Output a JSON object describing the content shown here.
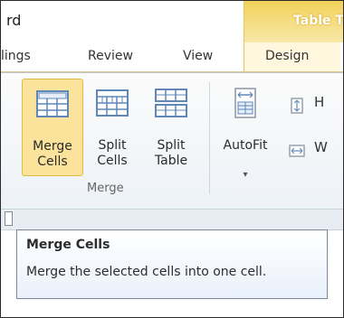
{
  "window": {
    "title_fragment": "rd",
    "contextual_tab_group": "Table T"
  },
  "ribbon_tabs": {
    "items": [
      {
        "label": "lings"
      },
      {
        "label": "Review"
      },
      {
        "label": "View"
      },
      {
        "label": "Design"
      }
    ],
    "active": "Design"
  },
  "merge_group": {
    "label": "Merge",
    "buttons": {
      "merge": {
        "line1": "Merge",
        "line2": "Cells"
      },
      "split_cells": {
        "line1": "Split",
        "line2": "Cells"
      },
      "split_table": {
        "line1": "Split",
        "line2": "Table"
      }
    }
  },
  "cell_size_group": {
    "autofit": {
      "line1": "AutoFit",
      "chevron": "▾"
    },
    "small_buttons": [
      {
        "icon": "cell-height-icon",
        "text": "H"
      },
      {
        "icon": "cell-width-icon",
        "text": "W"
      }
    ]
  },
  "tooltip": {
    "title": "Merge Cells",
    "description": "Merge the selected cells into one cell."
  },
  "colors": {
    "contextual_gold": "#f2d25a",
    "selected_button_fill": "#fbe39b",
    "ribbon_background": "#edf2f7"
  }
}
